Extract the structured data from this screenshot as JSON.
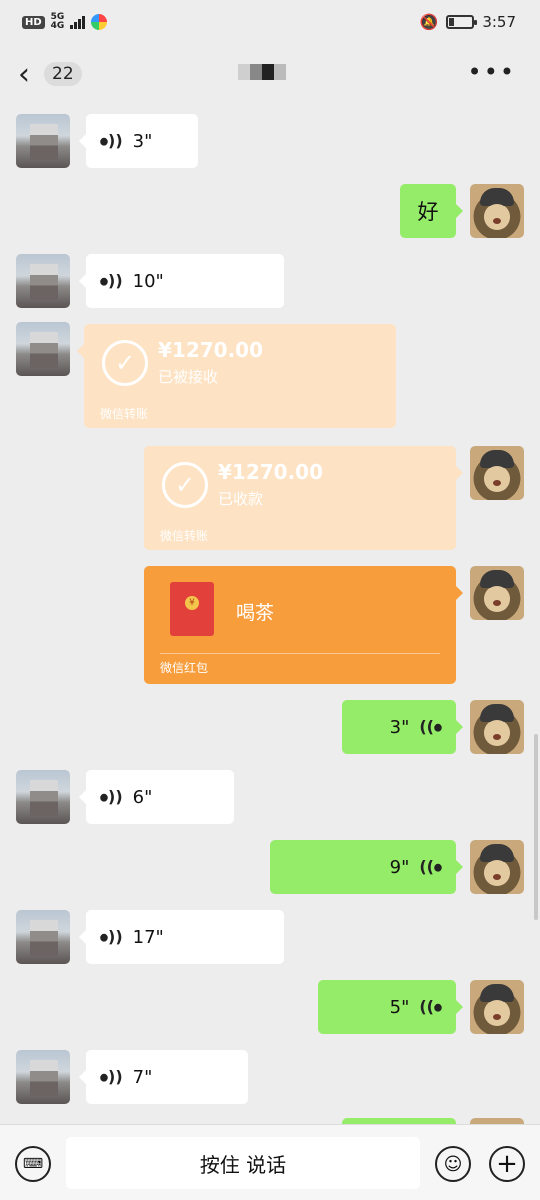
{
  "status_bar": {
    "hd": "HD",
    "network": "5G",
    "network_sub": "4G",
    "time": "3:57"
  },
  "nav": {
    "unread_count": "22"
  },
  "messages": [
    {
      "side": "in",
      "type": "voice",
      "duration": "3\""
    },
    {
      "side": "out",
      "type": "text",
      "text": "好"
    },
    {
      "side": "in",
      "type": "voice",
      "duration": "10\""
    },
    {
      "side": "in",
      "type": "transfer",
      "amount": "¥1270.00",
      "status": "已被接收",
      "footer": "微信转账"
    },
    {
      "side": "out",
      "type": "transfer",
      "amount": "¥1270.00",
      "status": "已收款",
      "footer": "微信转账"
    },
    {
      "side": "out",
      "type": "red_packet",
      "title": "喝茶",
      "footer": "微信红包"
    },
    {
      "side": "out",
      "type": "voice",
      "duration": "3\""
    },
    {
      "side": "in",
      "type": "voice",
      "duration": "6\""
    },
    {
      "side": "out",
      "type": "voice",
      "duration": "9\""
    },
    {
      "side": "in",
      "type": "voice",
      "duration": "17\""
    },
    {
      "side": "out",
      "type": "voice",
      "duration": "5\""
    },
    {
      "side": "in",
      "type": "voice",
      "duration": "7\""
    }
  ],
  "input_bar": {
    "talk_label": "按住 说话"
  },
  "colors": {
    "background": "#ededed",
    "bubble_out": "#95ec69",
    "bubble_in": "#ffffff",
    "transfer_received": "#fde2c3",
    "red_packet": "#f89d3c"
  }
}
